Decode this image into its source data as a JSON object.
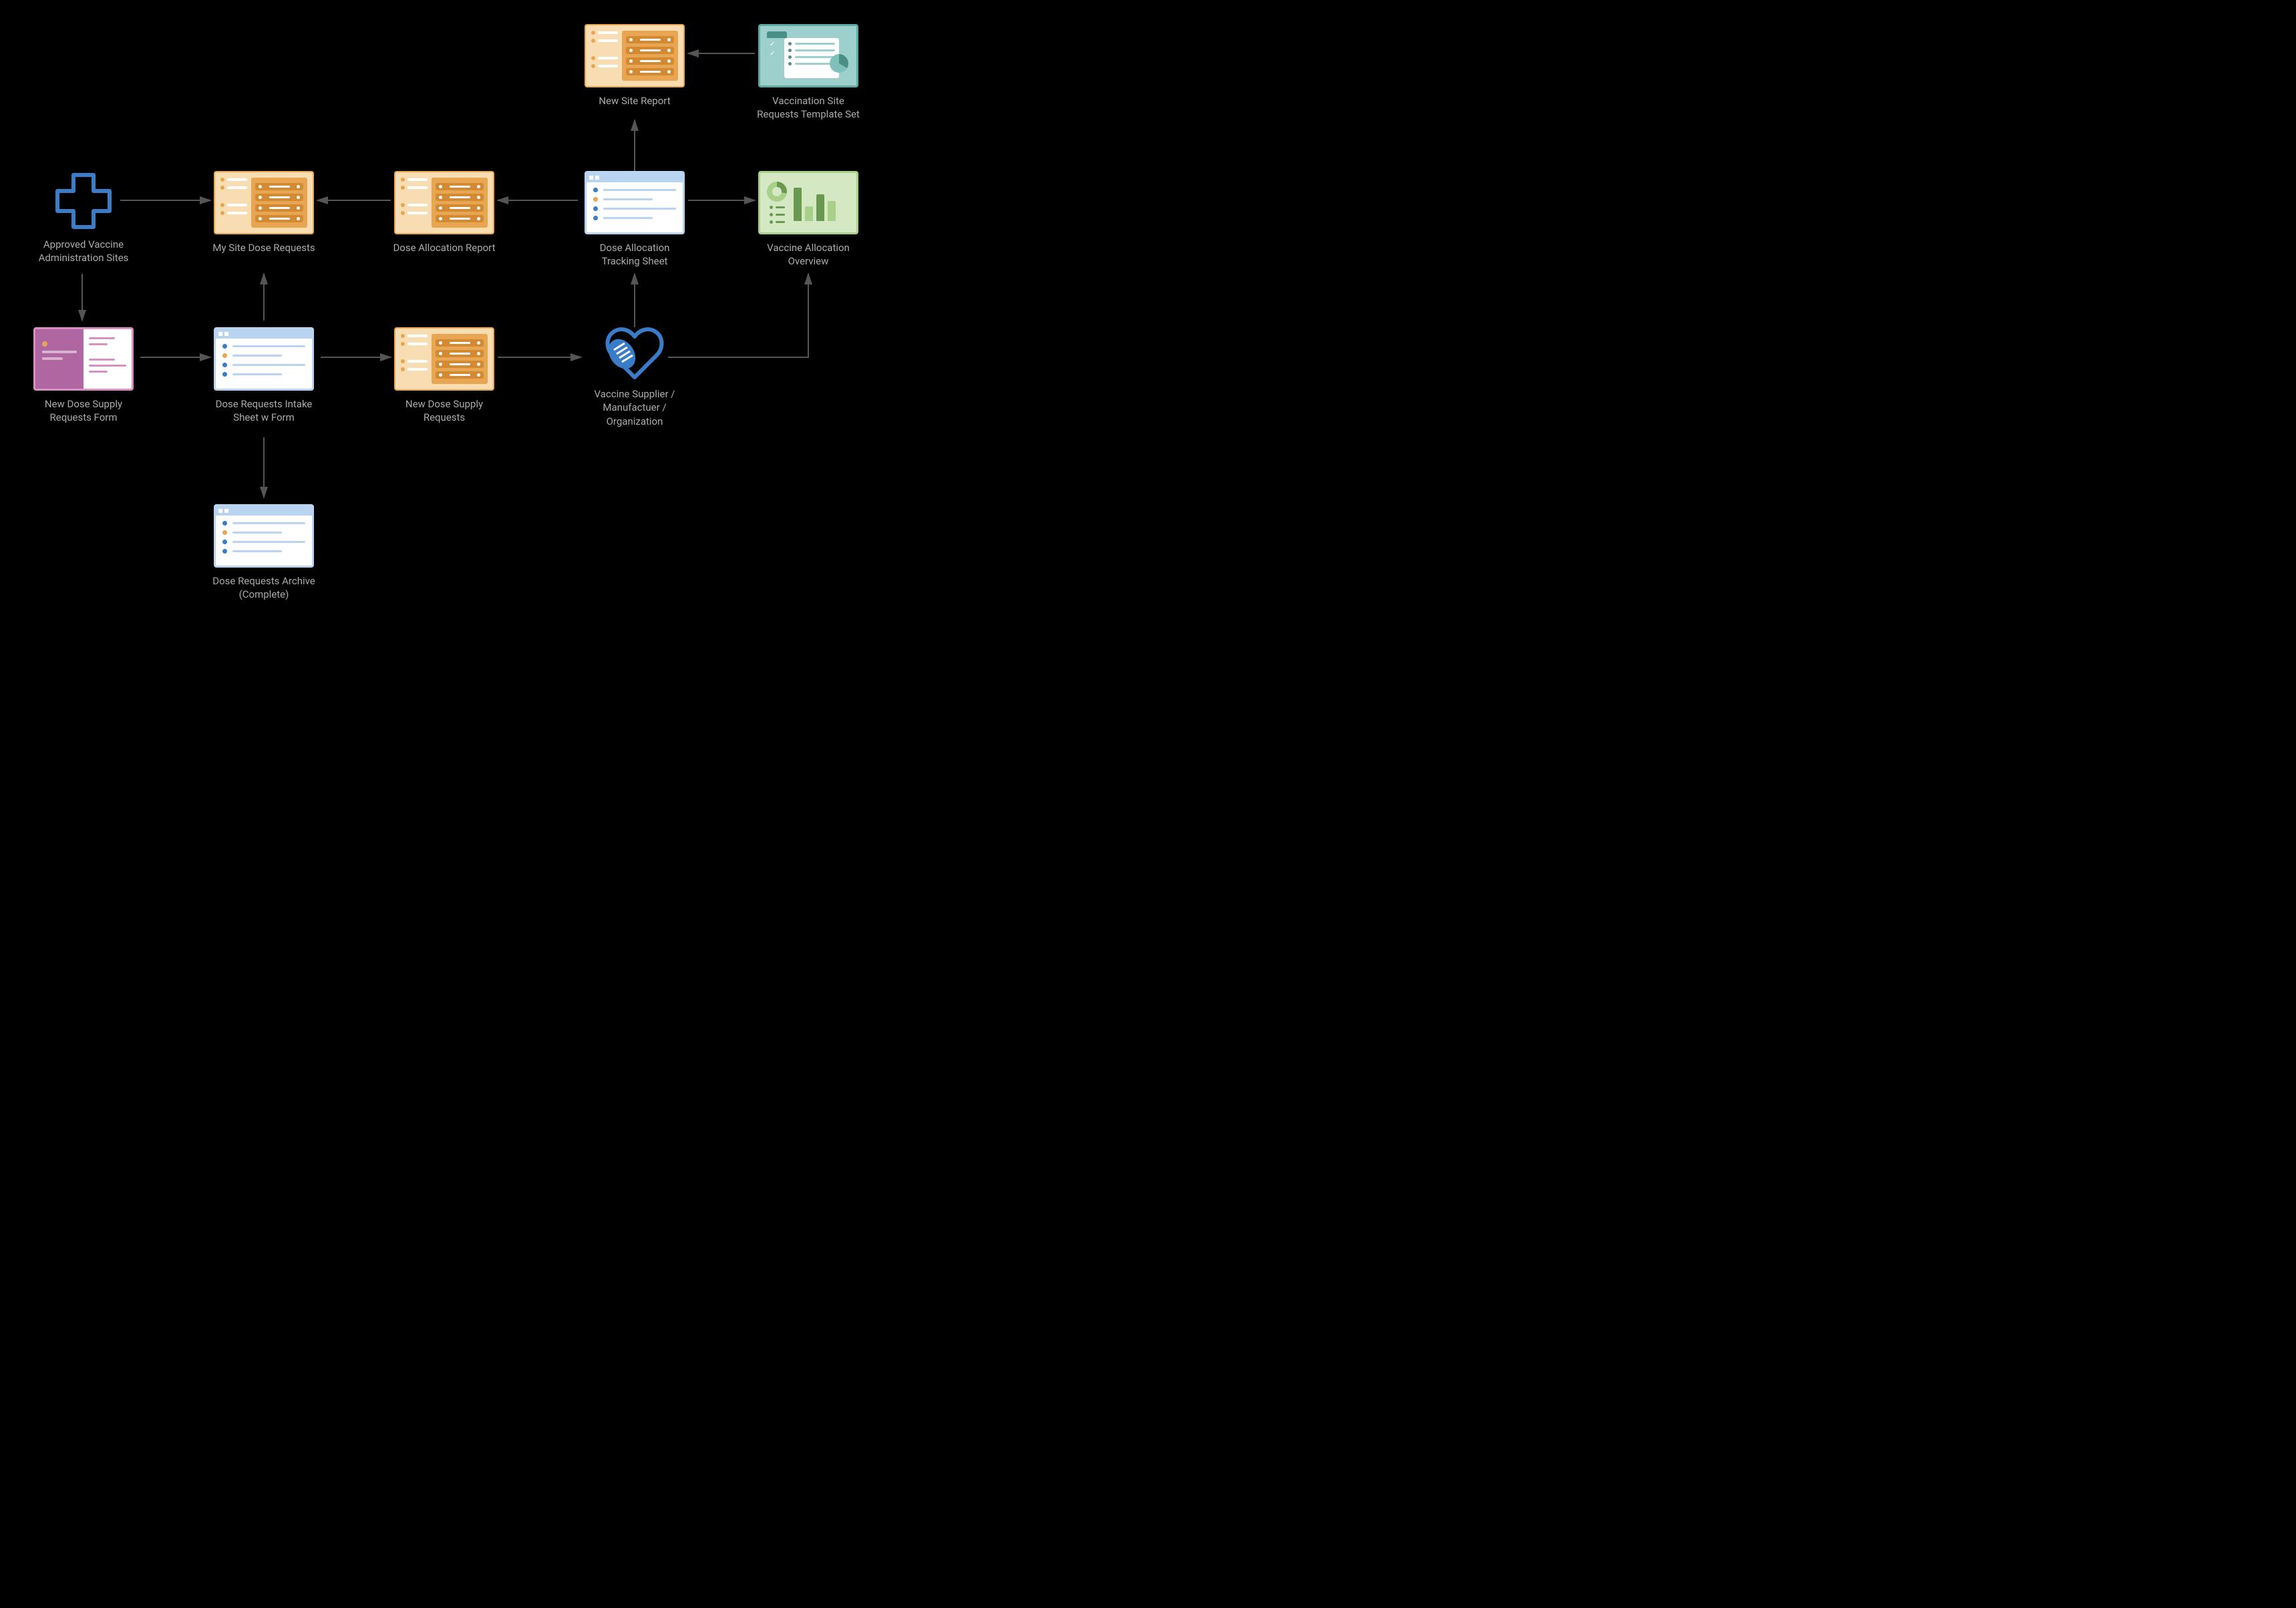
{
  "nodes": {
    "new_site_report": {
      "label": "New Site Report"
    },
    "template_set": {
      "label": "Vaccination Site Requests Template Set"
    },
    "approved_sites": {
      "label": "Approved Vaccine Administration Sites"
    },
    "my_site_dose": {
      "label": "My Site Dose Requests"
    },
    "dose_alloc_report": {
      "label": "Dose Allocation Report"
    },
    "dose_alloc_tracking": {
      "label": "Dose Allocation Tracking Sheet"
    },
    "vaccine_overview": {
      "label": "Vaccine Allocation Overview"
    },
    "new_dose_form": {
      "label": "New Dose Supply Requests Form"
    },
    "intake_sheet": {
      "label": "Dose Requests Intake Sheet w Form"
    },
    "new_dose_requests": {
      "label": "New Dose Supply Requests"
    },
    "supplier": {
      "label": "Vaccine Supplier / Manufactuer / Organization"
    },
    "archive": {
      "label": "Dose Requests Archive (Complete)"
    }
  },
  "colors": {
    "arrow": "#444444",
    "orange": "#e8a552",
    "blue": "#b8d4f0",
    "pink": "#d890c4",
    "teal": "#5fa9a4",
    "green": "#a8d088",
    "icon_blue": "#3a7cc8"
  }
}
